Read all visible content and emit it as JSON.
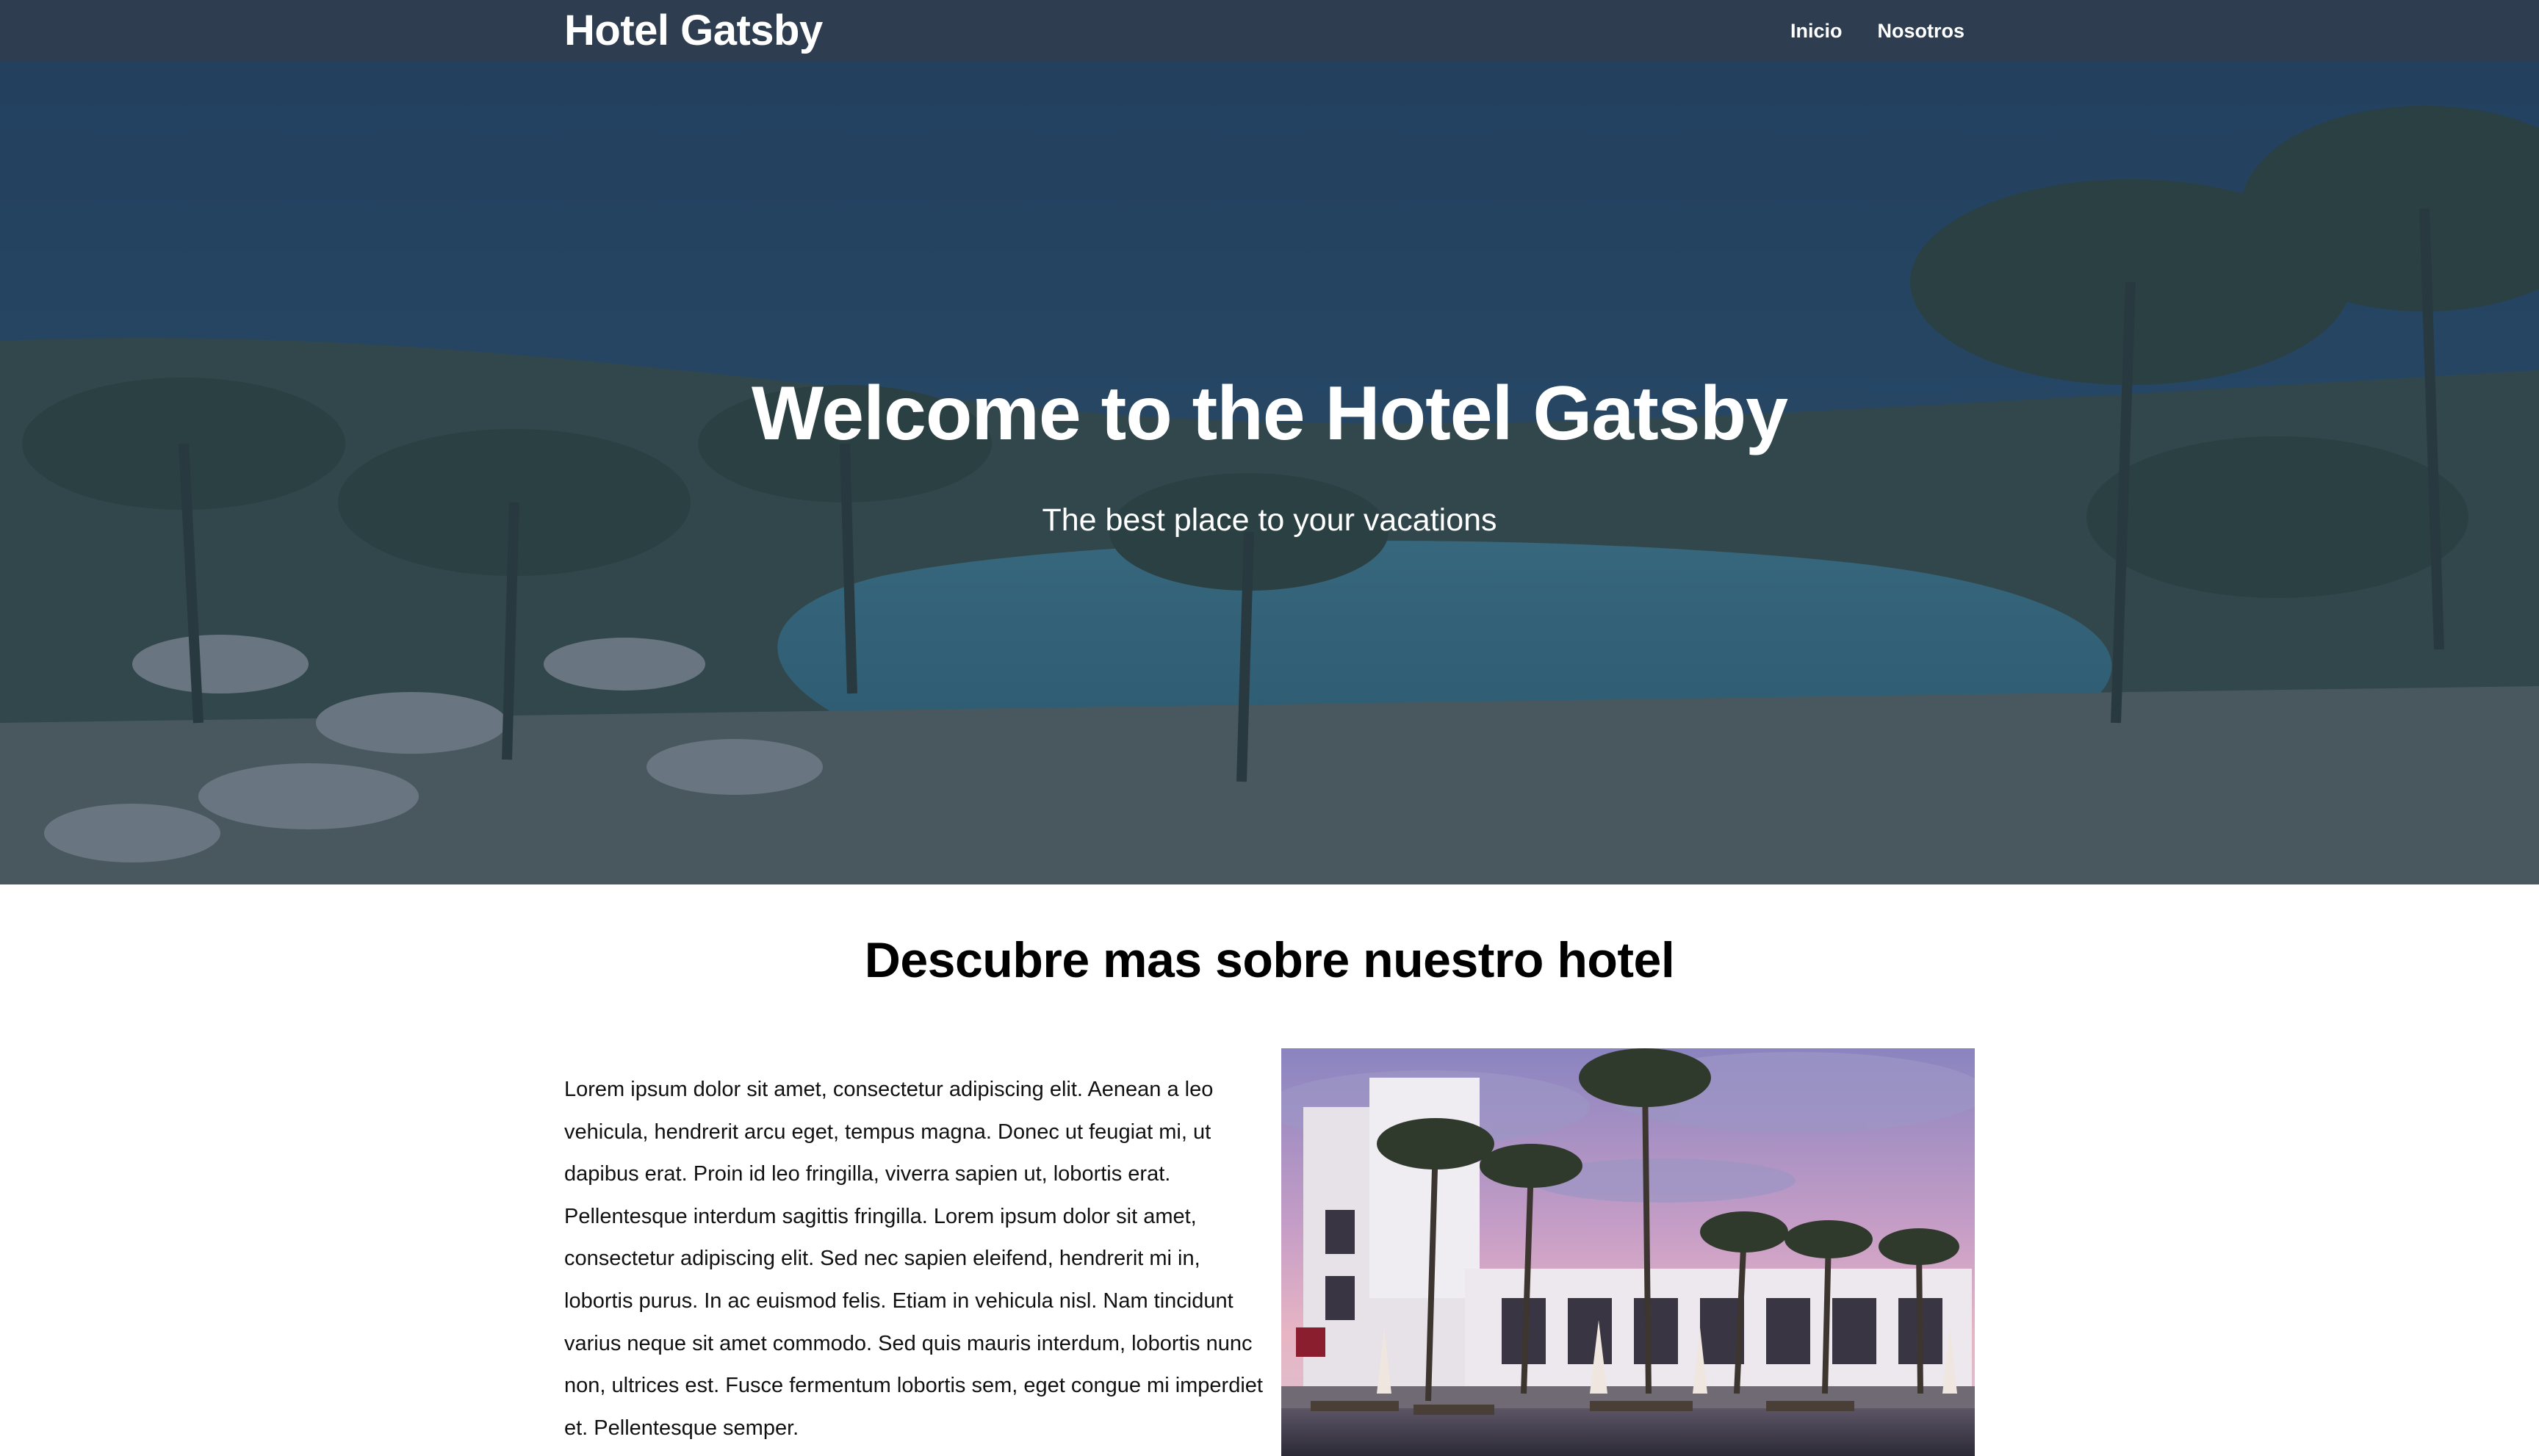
{
  "navbar": {
    "brand": "Hotel Gatsby",
    "links": [
      {
        "label": "Inicio"
      },
      {
        "label": "Nosotros"
      }
    ]
  },
  "hero": {
    "title": "Welcome to the Hotel Gatsby",
    "subtitle": "The best place to your vacations"
  },
  "about": {
    "title": "Descubre mas sobre nuestro hotel",
    "body": "Lorem ipsum dolor sit amet, consectetur adipiscing elit. Aenean a leo vehicula, hendrerit arcu eget, tempus magna. Donec ut feugiat mi, ut dapibus erat. Proin id leo fringilla, viverra sapien ut, lobortis erat. Pellentesque interdum sagittis fringilla. Lorem ipsum dolor sit amet, consectetur adipiscing elit. Sed nec sapien eleifend, hendrerit mi in, lobortis purus. In ac euismod felis. Etiam in vehicula nisl. Nam tincidunt varius neque sit amet commodo. Sed quis mauris interdum, lobortis nunc non, ultrices est. Fusce fermentum lobortis sem, eget congue mi imperdiet et. Pellentesque semper."
  },
  "colors": {
    "navbar_bg": "#2e3d4f",
    "hero_overlay": "#28384e",
    "text_light": "#ffffff",
    "text_dark": "#000000"
  }
}
